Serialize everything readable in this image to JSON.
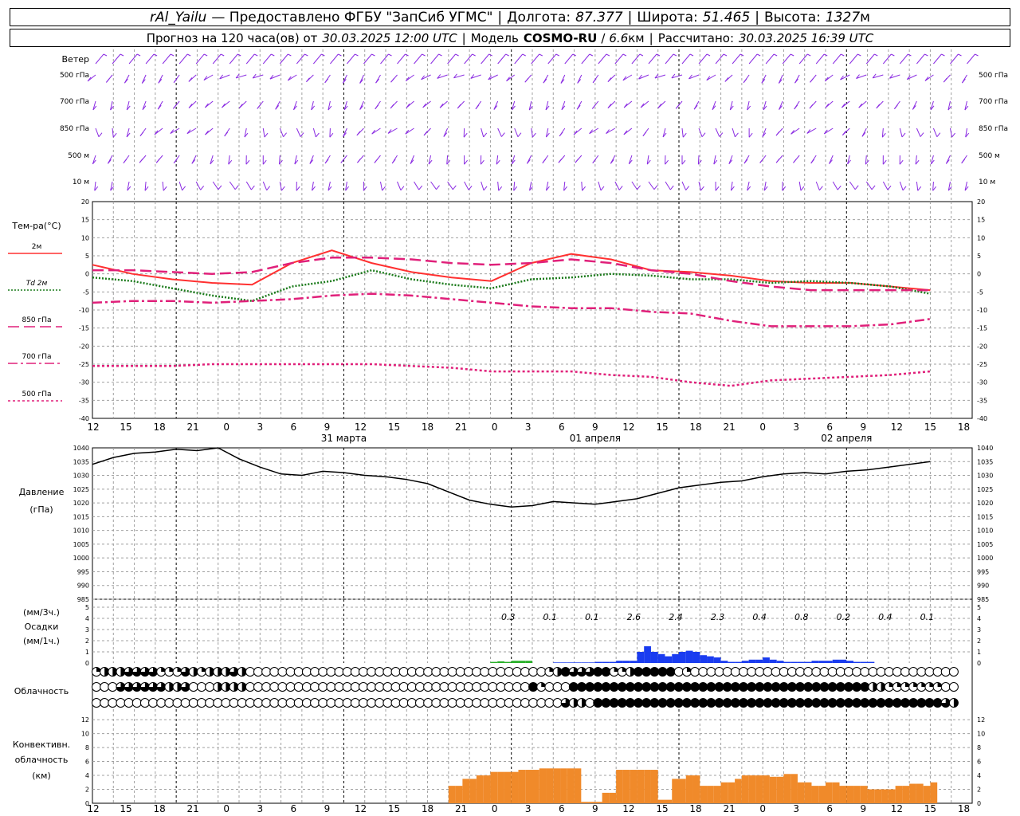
{
  "header": {
    "station": "rAl_Yailu",
    "provider": "— Предоставлено ФГБУ \"ЗапСиб УГМС\"",
    "lon_label": "Долгота:",
    "lon": "87.377",
    "lat_label": "Широта:",
    "lat": "51.465",
    "alt_label": "Высота:",
    "alt": "1327",
    "alt_unit": "м",
    "forecast_label": "Прогноз на 120 часа(ов) от",
    "forecast_time": "30.03.2025 12:00 UTC",
    "model_label": "Модель",
    "model": "COSMO-RU",
    "resolution": "6.6",
    "resolution_unit": "км",
    "calc_label": "Рассчитано:",
    "calc_time": "30.03.2025 16:39 UTC"
  },
  "colors": {
    "wind": "#8a2be2",
    "t2m": "#ff3030",
    "td2m": "#1a7a1a",
    "t850": "#e0207a",
    "t700": "#e0207a",
    "t500": "#e0207a",
    "pressure": "#000000",
    "precip": "#1a3cf0",
    "precip_light": "#2ab02a",
    "conv": "#f08a2a",
    "grid": "#a0a0a0",
    "day": "#000000"
  },
  "chart_data": [
    {
      "type": "wind",
      "panel_title": "Ветер",
      "levels": [
        "500 гПа",
        "700 гПа",
        "850 гПа",
        "500 м",
        "10 м"
      ]
    },
    {
      "type": "line",
      "panel_title": "Тем-ра(°C)",
      "ylim": [
        -40,
        20
      ],
      "yticks": [
        20,
        15,
        10,
        5,
        0,
        -5,
        -10,
        -15,
        -20,
        -25,
        -30,
        -35,
        -40
      ],
      "x_hours": [
        0,
        12,
        24,
        36,
        48,
        60,
        72,
        84,
        96,
        108,
        120
      ],
      "series": [
        {
          "name": "2м",
          "style": "solid",
          "values": [
            2.5,
            0,
            -1.5,
            -2.5,
            -3,
            3,
            6.5,
            3,
            0.5,
            -1,
            -2,
            3,
            5.5,
            4,
            1,
            0.5,
            -0.5,
            -2,
            -2.5,
            -2.5,
            -3.5,
            -4.5
          ]
        },
        {
          "name": "Td 2м",
          "style": "dotted",
          "values": [
            -1,
            -2,
            -4,
            -6,
            -7.5,
            -3.5,
            -2,
            1,
            -1.5,
            -3,
            -4,
            -1.5,
            -1,
            0,
            -0.5,
            -1.5,
            -1.5,
            -2.5,
            -2,
            -2.5,
            -3.5,
            -5.5
          ]
        },
        {
          "name": "850 гПа",
          "style": "dashed",
          "values": [
            1,
            1,
            0.5,
            0,
            0.5,
            3,
            4.5,
            4.5,
            4,
            3,
            2.5,
            3,
            4,
            3,
            1,
            0,
            -2,
            -3.5,
            -4.5,
            -4.5,
            -4.5,
            -4.5
          ]
        },
        {
          "name": "700 гПа",
          "style": "dashdot",
          "values": [
            -8,
            -7.5,
            -7.5,
            -8,
            -7.5,
            -7,
            -6,
            -5.5,
            -6,
            -7,
            -8,
            -9,
            -9.5,
            -9.5,
            -10.5,
            -11,
            -13,
            -14.5,
            -14.5,
            -14.5,
            -14,
            -12.5
          ]
        },
        {
          "name": "500 гПа",
          "style": "shortdash",
          "values": [
            -25.5,
            -25.5,
            -25.5,
            -25,
            -25,
            -25,
            -25,
            -25,
            -25.5,
            -26,
            -27,
            -27,
            -27,
            -28,
            -28.5,
            -30,
            -31,
            -29.5,
            -29,
            -28.5,
            -28,
            -27
          ]
        }
      ]
    },
    {
      "type": "line",
      "panel_title": "Давление",
      "panel_unit": "(гПа)",
      "ylim": [
        985,
        1040
      ],
      "yticks": [
        1040,
        1035,
        1030,
        1025,
        1020,
        1015,
        1010,
        1005,
        1000,
        995,
        990,
        985
      ],
      "x_hours": [
        0,
        3,
        6,
        9,
        12,
        15,
        18,
        21,
        24,
        27,
        30,
        33,
        36,
        39,
        42,
        45,
        48,
        51,
        54,
        57,
        60,
        63,
        66,
        69,
        72,
        75,
        78,
        81,
        84,
        87,
        90,
        93,
        96,
        99,
        102,
        105,
        108,
        111,
        114,
        117,
        120
      ],
      "values": [
        1034,
        1036.5,
        1038,
        1038.5,
        1039.5,
        1039,
        1040,
        1036,
        1033,
        1030.5,
        1030,
        1031.5,
        1031,
        1030,
        1029.5,
        1028.5,
        1027,
        1024,
        1021,
        1019.5,
        1018.5,
        1019,
        1020.5,
        1020,
        1019.5,
        1020.5,
        1021.5,
        1023.5,
        1025.5,
        1026.5,
        1027.5,
        1028,
        1029.5,
        1030.5,
        1031,
        1030.5,
        1031.5,
        1032,
        1033,
        1034,
        1035
      ]
    },
    {
      "type": "bar",
      "panel_title": "Осадки",
      "unit_top": "(мм/3ч.)",
      "unit_bottom": "(мм/1ч.)",
      "ylim": [
        0,
        5
      ],
      "yticks": [
        5,
        4,
        3,
        2,
        1,
        0
      ],
      "totals_3h": [
        "0.3",
        "0.1",
        "0.1",
        "2.6",
        "2.4",
        "2.3",
        "0.4",
        "0.8",
        "0.2",
        "0.4",
        "0.1"
      ],
      "hourly_start": 57,
      "hourly": [
        0.1,
        0.15,
        0.1,
        0.2,
        0.2,
        0.2,
        0,
        0,
        0,
        0.05,
        0.05,
        0.05,
        0.05,
        0.05,
        0.05,
        0.1,
        0.1,
        0.1,
        0.2,
        0.2,
        0.2,
        1.0,
        1.5,
        1.0,
        0.8,
        0.6,
        0.8,
        1.0,
        1.1,
        1.0,
        0.7,
        0.6,
        0.5,
        0.2,
        0.1,
        0.1,
        0.2,
        0.3,
        0.3,
        0.5,
        0.3,
        0.2,
        0.1,
        0.1,
        0.1,
        0.1,
        0.2,
        0.2,
        0.2,
        0.3,
        0.3,
        0.2,
        0.1,
        0.1,
        0.1
      ]
    },
    {
      "type": "table",
      "panel_title": "Облачность",
      "rows": [
        "12223333111321222320000000000000000000000000000000000000124333441124444401000000000000000000000000000000000",
        "00033333322300022220000000000000000000000000000000000041000444444444444444444444444444444444444422111111100",
        "00000000000000000000000000000000000000000000000000000000003220444444444444444444444444444444444444444444432"
      ]
    },
    {
      "type": "bar",
      "panel_title": "Конвективн. облачность (км)",
      "ylim": [
        0,
        13
      ],
      "yticks": [
        12,
        10,
        8,
        6,
        4,
        2,
        0
      ],
      "hourly_start": 51,
      "hourly": [
        2.5,
        2.5,
        3.5,
        3.5,
        4,
        4,
        4.5,
        4.5,
        4.5,
        4.5,
        4.8,
        4.8,
        4.8,
        5,
        5,
        5,
        5,
        5,
        5,
        0.2,
        0.2,
        0.2,
        1.5,
        1.5,
        4.8,
        4.8,
        4.8,
        4.8,
        4.8,
        4.8,
        0.5,
        0.5,
        3.5,
        3.5,
        4,
        4,
        2.5,
        2.5,
        2.5,
        3,
        3,
        3.5,
        4,
        4,
        4,
        4,
        3.8,
        3.8,
        4.2,
        4.2,
        3,
        3,
        2.5,
        2.5,
        3,
        3,
        2.5,
        2.5,
        2.5,
        2.5,
        2,
        2,
        2,
        2,
        2.5,
        2.5,
        2.8,
        2.8,
        2.5,
        3
      ]
    }
  ],
  "axis": {
    "tick_labels": [
      "12",
      "15",
      "18",
      "21",
      "0",
      "3",
      "6",
      "9",
      "12",
      "15",
      "18",
      "21",
      "0",
      "3",
      "6",
      "9",
      "12",
      "15",
      "18",
      "21",
      "0",
      "3",
      "6",
      "9",
      "12",
      "15",
      "18"
    ],
    "date_labels": [
      "31 марта",
      "01 апреля",
      "02 апреля"
    ],
    "date_label_hours": [
      36,
      72,
      108
    ]
  }
}
